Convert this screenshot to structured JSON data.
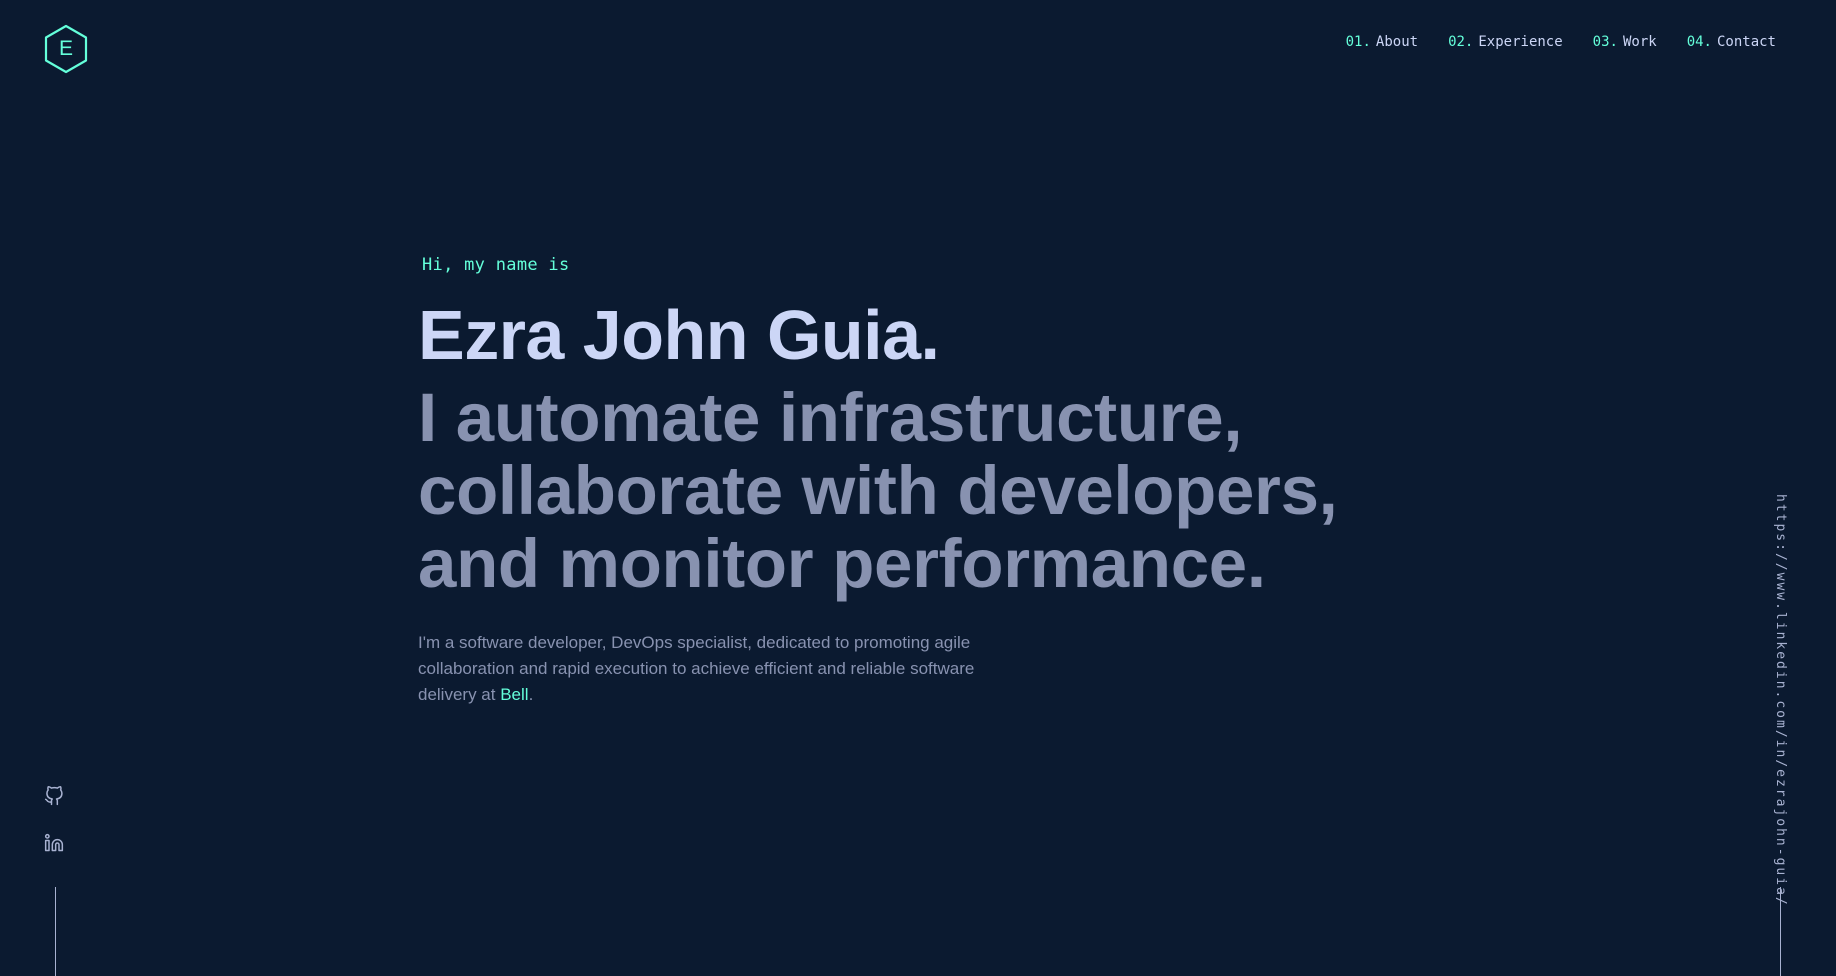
{
  "logo": {
    "letter": "E",
    "icon": "hexagon-logo-icon"
  },
  "nav": [
    {
      "num": "01.",
      "label": "About"
    },
    {
      "num": "02.",
      "label": "Experience"
    },
    {
      "num": "03.",
      "label": "Work"
    },
    {
      "num": "04.",
      "label": "Contact"
    }
  ],
  "hero": {
    "greeting": "Hi, my name is",
    "name": "Ezra John Guia.",
    "tagline_lines": [
      "I automate infrastructure,",
      "collaborate with developers,",
      "and monitor performance."
    ],
    "bio_prefix": "I'm a software developer, DevOps specialist, dedicated to promoting agile collaboration and rapid execution to achieve efficient and reliable software delivery at ",
    "bio_link": "Bell",
    "bio_suffix": "."
  },
  "social": [
    {
      "icon": "github-icon"
    },
    {
      "icon": "linkedin-icon"
    }
  ],
  "side_link": "https://www.linkedin.com/in/ezrajohn-guia/",
  "colors": {
    "background": "#0b1a30",
    "accent": "#64ffda",
    "heading": "#ccd6f6",
    "muted": "#8892b0"
  }
}
